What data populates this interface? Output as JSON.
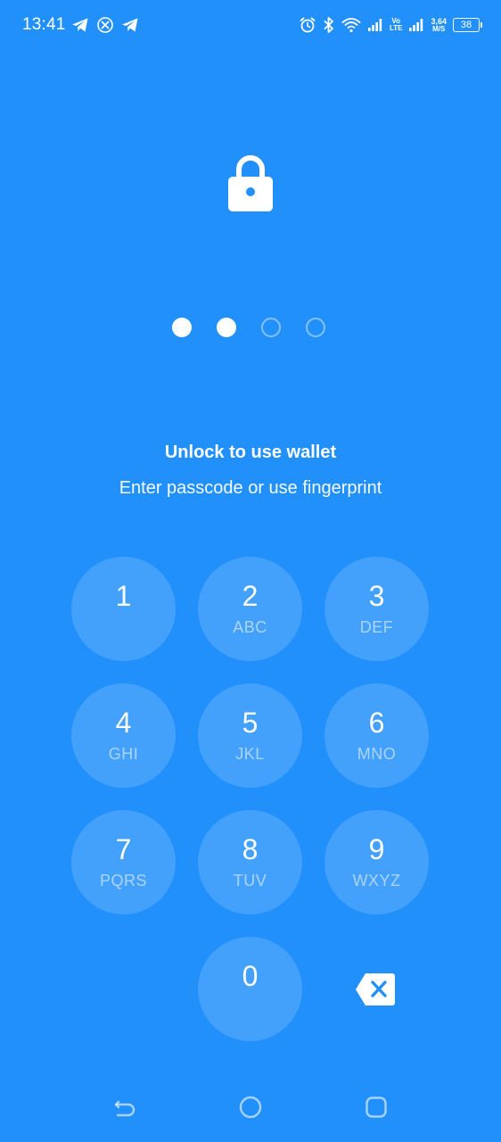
{
  "status_bar": {
    "time": "13:41",
    "network_speed_value": "3,64",
    "network_speed_unit": "M/S",
    "volte_top": "Vo",
    "volte_bottom": "LTE",
    "battery": "38",
    "left_icons": [
      "telegram-icon",
      "x-app-icon",
      "telegram-icon"
    ],
    "right_icons": [
      "alarm-icon",
      "bluetooth-icon",
      "wifi-icon",
      "signal-icon",
      "volte-icon",
      "signal-icon",
      "network-speed",
      "battery-icon"
    ]
  },
  "lock": {
    "icon": "lock-icon"
  },
  "passcode": {
    "length": 4,
    "entered": 2
  },
  "title": "Unlock to use wallet",
  "subtitle": "Enter passcode or use fingerprint",
  "keypad": {
    "keys": [
      {
        "digit": "1",
        "letters": ""
      },
      {
        "digit": "2",
        "letters": "ABC"
      },
      {
        "digit": "3",
        "letters": "DEF"
      },
      {
        "digit": "4",
        "letters": "GHI"
      },
      {
        "digit": "5",
        "letters": "JKL"
      },
      {
        "digit": "6",
        "letters": "MNO"
      },
      {
        "digit": "7",
        "letters": "PQRS"
      },
      {
        "digit": "8",
        "letters": "TUV"
      },
      {
        "digit": "9",
        "letters": "WXYZ"
      },
      {
        "digit": "0",
        "letters": ""
      }
    ],
    "backspace_icon": "backspace-icon"
  },
  "nav_bar": {
    "icons": [
      "back-icon",
      "home-icon",
      "recents-icon"
    ]
  },
  "colors": {
    "background": "#2190fb",
    "key_fill": "rgba(255,255,255,0.16)",
    "foreground": "#ffffff"
  }
}
